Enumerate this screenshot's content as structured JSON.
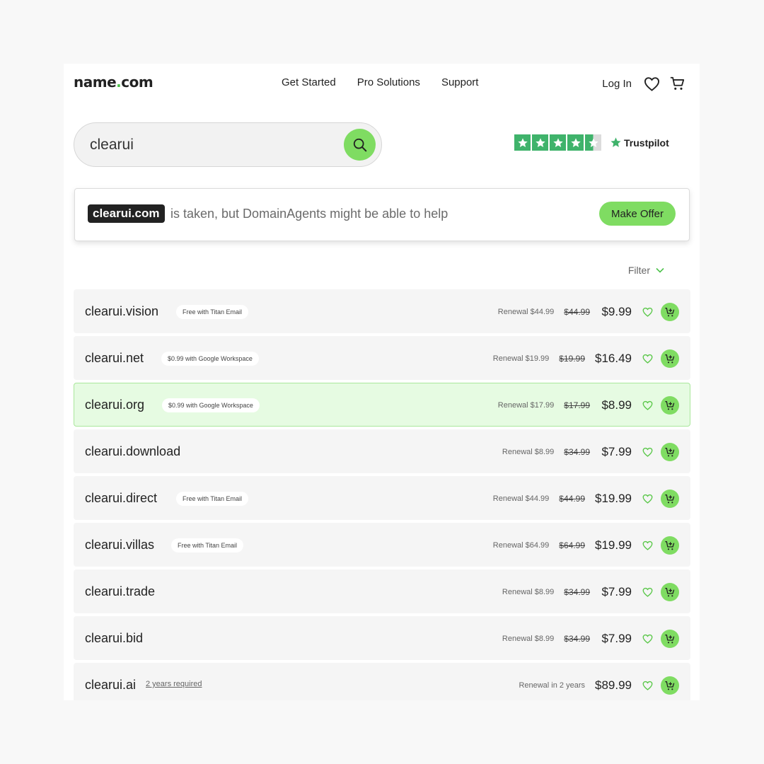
{
  "header": {
    "logo_main": "name",
    "logo_dot": ".",
    "logo_tld": "com",
    "nav": [
      "Get Started",
      "Pro Solutions",
      "Support"
    ],
    "login": "Log In"
  },
  "search": {
    "value": "clearui"
  },
  "trustpilot": {
    "rating_stars": 4.5,
    "brand": "Trustpilot"
  },
  "taken": {
    "domain": "clearui.com",
    "message": "is taken, but DomainAgents might be able to help",
    "button": "Make Offer"
  },
  "filter": {
    "label": "Filter"
  },
  "results": [
    {
      "name": "clearui.vision",
      "promo": "Free with Titan Email",
      "renewal": "Renewal $44.99",
      "old_price": "$44.99",
      "price": "$9.99"
    },
    {
      "name": "clearui.net",
      "promo": "$0.99 with Google Workspace",
      "renewal": "Renewal $19.99",
      "old_price": "$19.99",
      "price": "$16.49"
    },
    {
      "name": "clearui.org",
      "promo": "$0.99 with Google Workspace",
      "renewal": "Renewal $17.99",
      "old_price": "$17.99",
      "price": "$8.99"
    },
    {
      "name": "clearui.download",
      "promo": "",
      "renewal": "Renewal $8.99",
      "old_price": "$34.99",
      "price": "$7.99"
    },
    {
      "name": "clearui.direct",
      "promo": "Free with Titan Email",
      "renewal": "Renewal $44.99",
      "old_price": "$44.99",
      "price": "$19.99"
    },
    {
      "name": "clearui.villas",
      "promo": "Free with Titan Email",
      "renewal": "Renewal $64.99",
      "old_price": "$64.99",
      "price": "$19.99"
    },
    {
      "name": "clearui.trade",
      "promo": "",
      "renewal": "Renewal $8.99",
      "old_price": "$34.99",
      "price": "$7.99"
    },
    {
      "name": "clearui.bid",
      "promo": "",
      "renewal": "Renewal $8.99",
      "old_price": "$34.99",
      "price": "$7.99"
    },
    {
      "name": "clearui.ai",
      "requirement": "2 years required",
      "renewal": "Renewal in 2 years",
      "old_price": "",
      "price": "$89.99"
    }
  ],
  "colors": {
    "accent_green": "#7fdc62",
    "highlight_bg": "#e6fbe2",
    "trustpilot_green": "#3fb36b"
  }
}
